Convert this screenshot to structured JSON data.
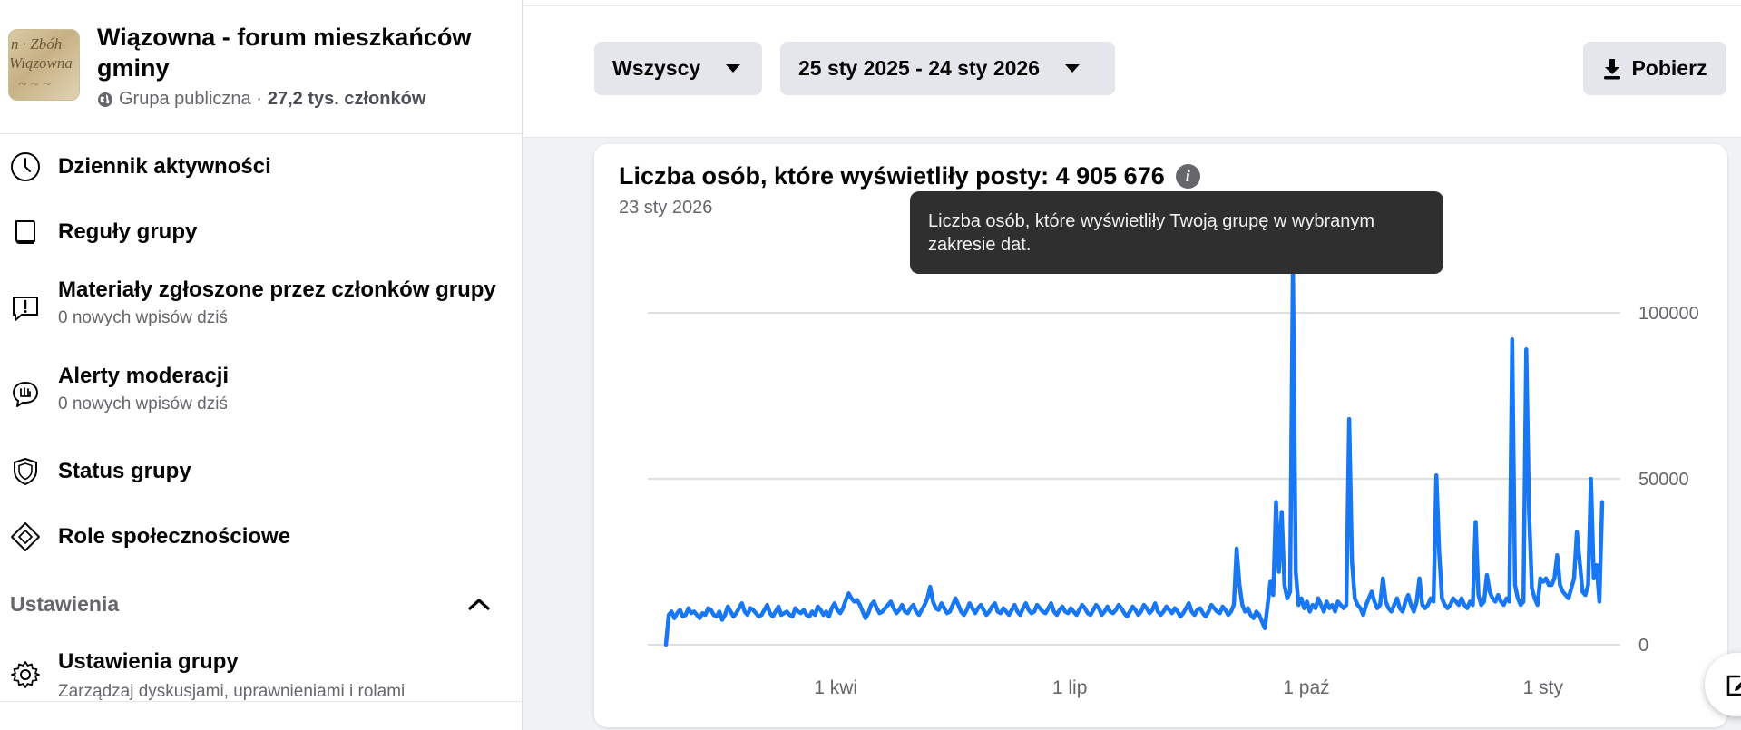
{
  "group": {
    "title": "Wiązowna - forum mieszkańców gminy",
    "privacy": "Grupa publiczna ·",
    "members": "27,2 tys. członków"
  },
  "sidebar": {
    "items": [
      {
        "label": "Dziennik aktywności",
        "icon": "clock-icon"
      },
      {
        "label": "Reguły grupy",
        "icon": "book-icon"
      },
      {
        "label": "Materiały zgłoszone przez członków grupy",
        "sub": "0 nowych wpisów dziś",
        "icon": "report-icon"
      },
      {
        "label": "Alerty moderacji",
        "sub": "0 nowych wpisów dziś",
        "icon": "alert-bubble-icon"
      },
      {
        "label": "Status grupy",
        "icon": "shield-icon"
      },
      {
        "label": "Role społecznościowe",
        "icon": "diamond-icon"
      }
    ],
    "section_label": "Ustawienia",
    "settings_item": {
      "label": "Ustawienia grupy",
      "sub": "Zarządzaj dyskusjami, uprawnieniami i rolami",
      "icon": "gear-icon"
    }
  },
  "toolbar": {
    "audience_filter": "Wszyscy",
    "date_range": "25 sty 2025 - 24 sty 2026",
    "download_label": "Pobierz"
  },
  "card": {
    "title": "Liczba osób, które wyświetliły posty: 4 905 676",
    "date": "23 sty 2026",
    "tooltip": "Liczba osób, które wyświetliły Twoją grupę w wybranym zakresie dat."
  },
  "colors": {
    "line": "#1877f2",
    "accent_bg": "#e4e6eb",
    "tooltip_bg": "#2f2f2f"
  },
  "chart_data": {
    "type": "line",
    "title": "",
    "xlabel": "",
    "ylabel": "",
    "x_range": [
      "2025-01-25",
      "2026-01-24"
    ],
    "x_ticks": [
      "1 kwi",
      "1 lip",
      "1 paź",
      "1 sty"
    ],
    "y_ticks": [
      0,
      50000,
      100000
    ],
    "ylim": [
      0,
      112000
    ],
    "grid": true,
    "series": [
      {
        "values": [
          0,
          9000,
          10000,
          8000,
          9500,
          10500,
          8500,
          9000,
          11000,
          9500,
          10000,
          9000,
          8000,
          9500,
          9000,
          11000,
          10500,
          9000,
          8500,
          10000,
          7500,
          9000,
          11500,
          10000,
          8500,
          9500,
          11000,
          12500,
          10000,
          9000,
          11000,
          10500,
          9500,
          8500,
          9000,
          10500,
          12000,
          9500,
          8500,
          10000,
          11500,
          9000,
          9500,
          10000,
          9000,
          8500,
          11000,
          10000,
          9500,
          10500,
          9000,
          8500,
          10000,
          9000,
          11500,
          10500,
          9000,
          10000,
          8500,
          11000,
          12500,
          10500,
          9500,
          11000,
          13500,
          15500,
          14000,
          13000,
          13500,
          12000,
          10000,
          8000,
          9500,
          12000,
          13000,
          11000,
          9500,
          10000,
          11000,
          12000,
          13000,
          11000,
          9500,
          10500,
          12000,
          10000,
          9500,
          11000,
          12000,
          10000,
          9000,
          10500,
          12000,
          14000,
          17500,
          13000,
          11000,
          10500,
          12500,
          11000,
          9500,
          10000,
          12000,
          14000,
          12000,
          10000,
          9000,
          10500,
          12500,
          11000,
          9500,
          11000,
          12000,
          10500,
          9000,
          10000,
          11500,
          12500,
          10000,
          9500,
          11000,
          10000,
          9000,
          10500,
          12000,
          10000,
          9000,
          11000,
          12500,
          10500,
          9500,
          10000,
          12000,
          11000,
          10000,
          9500,
          11000,
          12500,
          10000,
          9000,
          10500,
          11500,
          10000,
          9500,
          11000,
          10000,
          9000,
          10500,
          12000,
          11000,
          9500,
          9000,
          10500,
          12000,
          11000,
          9000,
          10000,
          11500,
          10000,
          9500,
          10500,
          12000,
          11000,
          9500,
          8500,
          10000,
          11500,
          10500,
          9000,
          10000,
          12000,
          11000,
          9500,
          10500,
          12500,
          10000,
          9000,
          10000,
          11500,
          10500,
          9500,
          11000,
          10000,
          8500,
          9500,
          11000,
          12500,
          10000,
          9000,
          10500,
          11000,
          9500,
          8500,
          10000,
          12000,
          11000,
          10000,
          9500,
          11500,
          10500,
          9000,
          10000,
          12000,
          29000,
          18000,
          12000,
          10000,
          11000,
          9000,
          8000,
          10000,
          9000,
          7000,
          5000,
          12000,
          19000,
          15000,
          43000,
          22000,
          40000,
          18000,
          14000,
          16000,
          115000,
          22000,
          12000,
          14000,
          11000,
          13000,
          10000,
          12000,
          11000,
          14000,
          12000,
          10000,
          13000,
          11000,
          12000,
          10000,
          13000,
          12000,
          11000,
          12000,
          68000,
          25000,
          14000,
          12000,
          11000,
          9000,
          12000,
          14000,
          16000,
          13000,
          11000,
          12000,
          20000,
          13000,
          11000,
          10000,
          12000,
          14000,
          11000,
          10000,
          13000,
          15000,
          12000,
          10000,
          13000,
          20000,
          12000,
          11000,
          12000,
          14000,
          13000,
          51000,
          28000,
          14000,
          12000,
          11000,
          12000,
          14000,
          13000,
          12000,
          14000,
          12000,
          11000,
          13000,
          12000,
          37000,
          15000,
          12000,
          13000,
          21000,
          16000,
          14000,
          13000,
          15000,
          13000,
          12000,
          14000,
          13000,
          92000,
          18000,
          14000,
          12000,
          13000,
          89000,
          40000,
          17000,
          14000,
          12000,
          20000,
          19000,
          20000,
          18000,
          18000,
          20000,
          27000,
          18000,
          16000,
          15000,
          14000,
          17000,
          20000,
          34000,
          25000,
          16000,
          15000,
          18000,
          50000,
          20000,
          24000,
          13000,
          43000
        ]
      }
    ]
  }
}
